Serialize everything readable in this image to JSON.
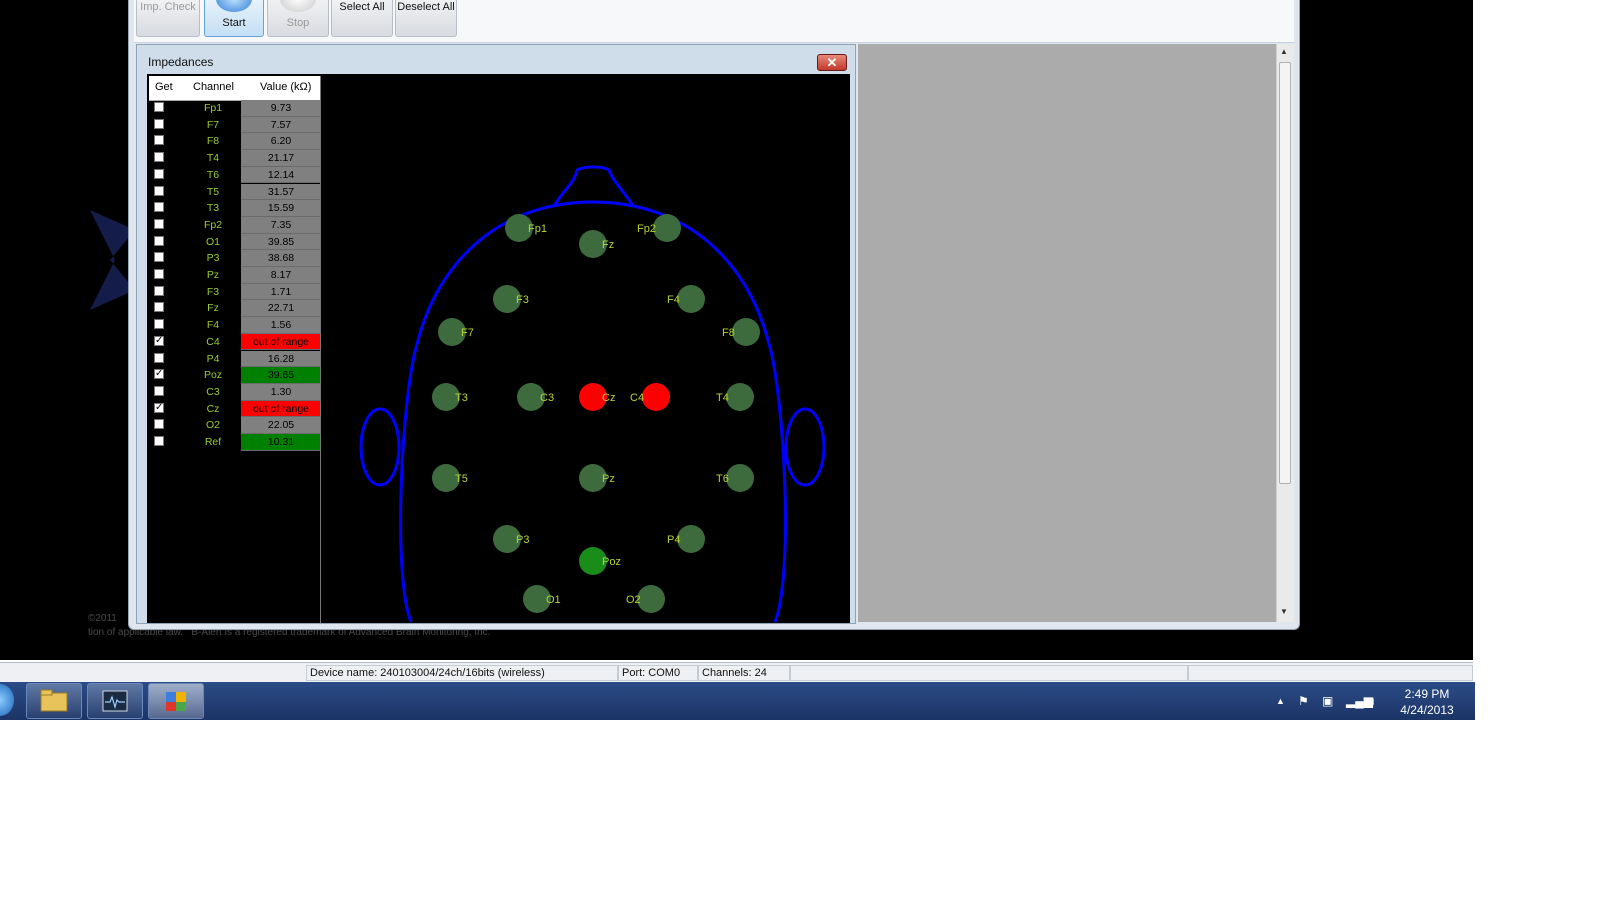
{
  "toolbar": {
    "buttons": [
      {
        "label": "Imp. Check",
        "enabled": false
      },
      {
        "label": "Start",
        "enabled": true
      },
      {
        "label": "Stop",
        "enabled": false
      },
      {
        "label": "Select All",
        "enabled": true
      },
      {
        "label": "Deselect All",
        "enabled": true
      }
    ]
  },
  "impedance_window": {
    "title": "Impedances",
    "close_glyph": "✕",
    "table_headers": {
      "get": "Get",
      "channel": "Channel",
      "value": "Value (kΩ)"
    },
    "rows": [
      {
        "checked": false,
        "channel": "Fp1",
        "value": "9.73",
        "status": "normal"
      },
      {
        "checked": false,
        "channel": "F7",
        "value": "7.57",
        "status": "normal"
      },
      {
        "checked": false,
        "channel": "F8",
        "value": "6.20",
        "status": "normal"
      },
      {
        "checked": false,
        "channel": "T4",
        "value": "21.17",
        "status": "normal"
      },
      {
        "checked": false,
        "channel": "T6",
        "value": "12.14",
        "status": "normal"
      },
      {
        "checked": false,
        "channel": "T5",
        "value": "31.57",
        "status": "normal"
      },
      {
        "checked": false,
        "channel": "T3",
        "value": "15.59",
        "status": "normal"
      },
      {
        "checked": false,
        "channel": "Fp2",
        "value": "7.35",
        "status": "normal"
      },
      {
        "checked": false,
        "channel": "O1",
        "value": "39.85",
        "status": "normal"
      },
      {
        "checked": false,
        "channel": "P3",
        "value": "38.68",
        "status": "normal"
      },
      {
        "checked": false,
        "channel": "Pz",
        "value": "8.17",
        "status": "normal"
      },
      {
        "checked": false,
        "channel": "F3",
        "value": "1.71",
        "status": "normal"
      },
      {
        "checked": false,
        "channel": "Fz",
        "value": "22.71",
        "status": "normal"
      },
      {
        "checked": false,
        "channel": "F4",
        "value": "1.56",
        "status": "normal"
      },
      {
        "checked": true,
        "channel": "C4",
        "value": "out of range",
        "status": "out"
      },
      {
        "checked": false,
        "channel": "P4",
        "value": "16.28",
        "status": "normal"
      },
      {
        "checked": true,
        "channel": "Poz",
        "value": "39.65",
        "status": "good"
      },
      {
        "checked": false,
        "channel": "C3",
        "value": "1.30",
        "status": "normal"
      },
      {
        "checked": true,
        "channel": "Cz",
        "value": "out of range",
        "status": "out"
      },
      {
        "checked": false,
        "channel": "O2",
        "value": "22.05",
        "status": "normal"
      },
      {
        "checked": false,
        "channel": "Ref",
        "value": "10.31",
        "status": "good"
      }
    ],
    "electrodes": [
      {
        "label": "Fp1",
        "status": "normal"
      },
      {
        "label": "Fp2",
        "status": "normal"
      },
      {
        "label": "Fz",
        "status": "normal"
      },
      {
        "label": "F3",
        "status": "normal"
      },
      {
        "label": "F4",
        "status": "normal"
      },
      {
        "label": "F7",
        "status": "normal"
      },
      {
        "label": "F8",
        "status": "normal"
      },
      {
        "label": "T3",
        "status": "normal"
      },
      {
        "label": "C3",
        "status": "normal"
      },
      {
        "label": "Cz",
        "status": "out"
      },
      {
        "label": "C4",
        "status": "out"
      },
      {
        "label": "T4",
        "status": "normal"
      },
      {
        "label": "T5",
        "status": "normal"
      },
      {
        "label": "Pz",
        "status": "normal"
      },
      {
        "label": "T6",
        "status": "normal"
      },
      {
        "label": "P3",
        "status": "normal"
      },
      {
        "label": "P4",
        "status": "normal"
      },
      {
        "label": "Poz",
        "status": "good"
      },
      {
        "label": "O1",
        "status": "normal"
      },
      {
        "label": "O2",
        "status": "normal"
      }
    ]
  },
  "colors": {
    "status_normal": "#808080",
    "status_out": "#ff0000",
    "status_good": "#008000",
    "dot_normal": "#3e6b3e",
    "dot_out": "#ff0000",
    "dot_good": "#1a8c1a",
    "label_color": "#b5d334",
    "head_outline": "#0000ff"
  },
  "background_text": "©2011\ntion of applicable law.   B-Alert is a registered trademark of Advanced Brain Monitoring, Inc.",
  "statusbar": {
    "device": "Device name: 240103004/24ch/16bits (wireless)",
    "port": "Port: COM0",
    "channels": "Channels: 24"
  },
  "taskbar": {
    "time": "2:49 PM",
    "date": "4/24/2013",
    "apps": [
      "file-explorer-icon",
      "eeg-monitor-icon",
      "control-panel-icon"
    ]
  }
}
